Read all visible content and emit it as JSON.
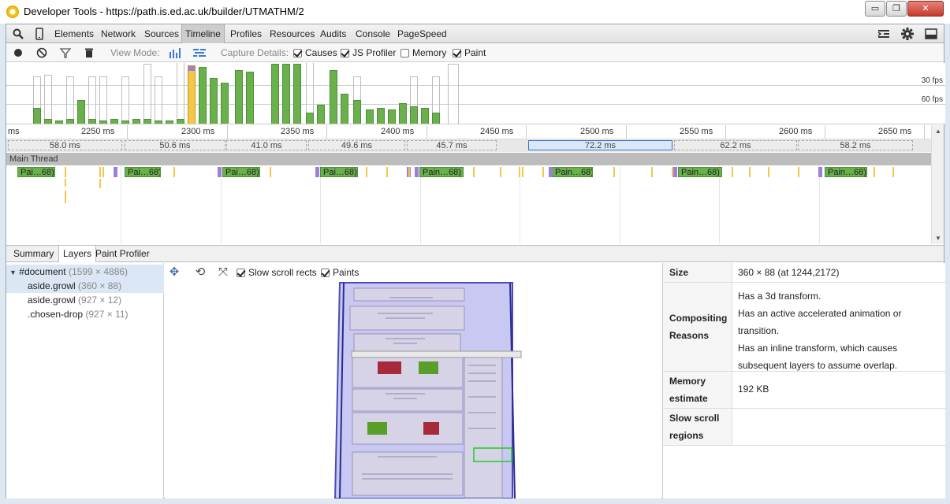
{
  "window": {
    "title": "Developer Tools - https://path.is.ed.ac.uk/builder/UTMATHM/2",
    "min": "▭",
    "max": "❐",
    "close": "✕"
  },
  "toolbar": {
    "tabs": [
      "Elements",
      "Network",
      "Sources",
      "Timeline",
      "Profiles",
      "Resources",
      "Audits",
      "Console",
      "PageSpeed"
    ],
    "active_tab": "Timeline"
  },
  "controls": {
    "view_mode_label": "View Mode:",
    "capture_label": "Capture Details:",
    "causes": "Causes",
    "js_profiler": "JS Profiler",
    "memory": "Memory",
    "paint": "Paint"
  },
  "overview": {
    "fps30": "30 fps",
    "fps60": "60 fps"
  },
  "ruler": {
    "ticks": [
      "ms",
      "2250 ms",
      "2300 ms",
      "2350 ms",
      "2400 ms",
      "2450 ms",
      "2500 ms",
      "2550 ms",
      "2600 ms",
      "2650 ms"
    ]
  },
  "frames": [
    "58.0 ms",
    "50.6 ms",
    "41.0 ms",
    "49.6 ms",
    "45.7 ms",
    "72.2 ms",
    "62.2 ms",
    "58.2 ms"
  ],
  "main_thread": {
    "label": "Main Thread",
    "events": [
      "Pai…68)",
      "Pai…68)",
      "Pai…68)",
      "Pai…68)",
      "Pain…68)",
      "Pain…68)",
      "Pain…68)",
      "Pain…68)"
    ]
  },
  "lower_tabs": {
    "items": [
      "Summary",
      "Layers",
      "Paint Profiler"
    ],
    "active": "Layers"
  },
  "layers_tree": {
    "rows": [
      {
        "name": "#document",
        "size": "(1599 × 4886)"
      },
      {
        "name": "aside.growl",
        "size": "(360 × 88)"
      },
      {
        "name": "aside.growl",
        "size": "(927 × 12)"
      },
      {
        "name": ".chosen-drop",
        "size": "(927 × 11)"
      }
    ]
  },
  "viewport": {
    "slow_scroll_rects": "Slow scroll rects",
    "paints": "Paints"
  },
  "details": {
    "size_label": "Size",
    "size_value": "360 × 88 (at 1244,2172)",
    "compositing_label": "Compositing Reasons",
    "compositing_reasons": [
      "Has a 3d transform.",
      "Has an active accelerated animation or",
      "transition.",
      "Has an inline transform, which causes",
      "subsequent layers to assume overlap."
    ],
    "memory_label": "Memory estimate",
    "memory_value": "192 KB",
    "slow_scroll_label": "Slow scroll regions",
    "slow_scroll_value": ""
  }
}
